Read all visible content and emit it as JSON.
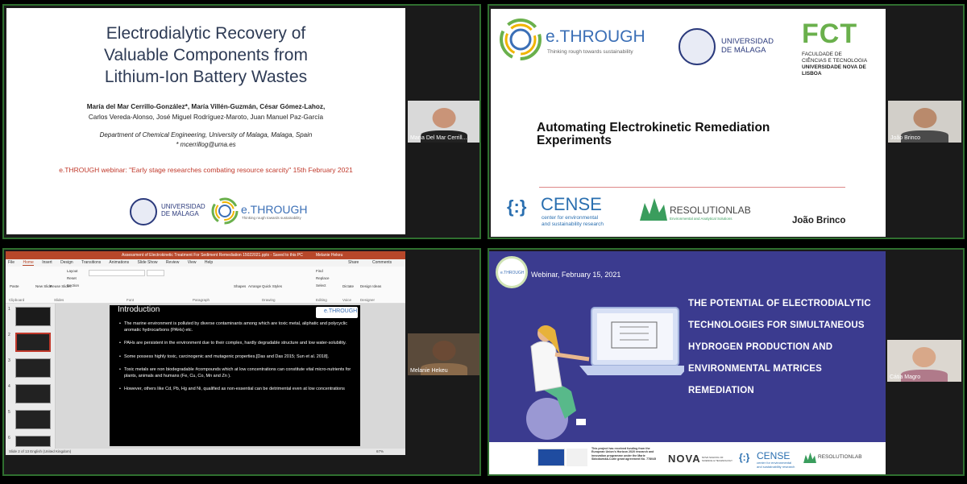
{
  "tiles": [
    {
      "slide": {
        "title_lines": [
          "Electrodialytic Recovery of",
          "Valuable Components from",
          "Lithium-Ion Battery Wastes"
        ],
        "authors_line1": "María del Mar Cerrillo-González*, María Villén-Guzmán, César Gómez-Lahoz,",
        "authors_line2": "Carlos Vereda-Alonso, José Miguel Rodríguez-Maroto, Juan Manuel Paz-García",
        "dept": "Department  of Chemical Engineering, University of Malaga, Malaga, Spain",
        "email": "* mcerrillog@uma.es",
        "webinar": "e.THROUGH webinar:  \"Early stage researches combating resource scarcity\" 15th February 2021",
        "logo_uni": [
          "UNIVERSIDAD",
          "DE MÁLAGA"
        ],
        "logo_brand": "e.THROUGH",
        "logo_tagline": "Thinking rough towards sustainability"
      },
      "participant": "María Del Mar Cerrill..."
    },
    {
      "slide": {
        "brand": "e.THROUGH",
        "brand_tagline": "Thinking rough towards sustainability",
        "uni": [
          "UNIVERSIDAD",
          "DE MÁLAGA"
        ],
        "fct": "FCT",
        "fct_lines": [
          "FACULDADE DE",
          "CIÊNCIAS E TECNOLOGIA",
          "UNIVERSIDADE NOVA DE LISBOA"
        ],
        "title_lines": [
          "Automating Electrokinetic Remediation",
          "Experiments"
        ],
        "cense": "CENSE",
        "cense_sub": [
          "center for environmental",
          "and sustainability research"
        ],
        "resolution": "RESOLUTIONLAB",
        "resolution_sub": "Environmental and Analytical Solutions",
        "presenter": "João Brinco"
      },
      "participant": "João Brinco"
    },
    {
      "ppt": {
        "window_title": "Assessment of  Electrokinetic  Treatment For Sediment Remediation 15022021.pptx  -  Saved to this PC",
        "user": "Melanie Hekeu",
        "tabs": [
          "File",
          "Home",
          "Insert",
          "Design",
          "Transitions",
          "Animations",
          "Slide Show",
          "Review",
          "View",
          "Help"
        ],
        "share": "Share",
        "comments": "Comments",
        "ribbon_buttons": [
          "Paste",
          "New Slide",
          "Reuse Slides",
          "Layout",
          "Reset",
          "Section",
          "Shapes",
          "Arrange",
          "Quick Styles",
          "Find",
          "Replace",
          "Select",
          "Dictate",
          "Design Ideas"
        ],
        "ribbon_groups": [
          "Clipboard",
          "Slides",
          "Font",
          "Paragraph",
          "Drawing",
          "Editing",
          "Voice",
          "Designer"
        ],
        "thumb_numbers": [
          "1",
          "2",
          "3",
          "4",
          "5",
          "6"
        ],
        "status": "Slide 2 of 13     English (United Kingdom)",
        "zoom": "67%",
        "slide_title": "Introduction",
        "slide_logo": "e.THROUGH",
        "bullets": [
          "The marine environment is polluted by diverse contaminants among which are toxic metal, aliphatic and polycyclic aromatic hydrocarbons (PAHs) etc.",
          "PAHs are persistent in the environment due to their complex, hardly degradable structure and low water-solubility.",
          "Some possess highly toxic, carcinogenic and mutagenic properties.[Das and Das 2015; Sun et al. 2018].",
          "Toxic metals are non biodegradable #compounds which at low concentrations can constitute vital micro-nutrients for plants, animals and humans (Fe, Cu, Co, Mn and Zn ).",
          "However, others like Cd, Pb, Hg and Ni, qualified as non-essential can be detrimental even at low concentrations"
        ]
      },
      "participant": "Melanie Hekeu"
    },
    {
      "slide": {
        "logo": "e.THROUGH",
        "date": "Webinar, February 15, 2021",
        "heading_lines": [
          "THE POTENTIAL OF ELECTRODIALYTIC",
          "TECHNOLOGIES FOR SIMULTANEOUS",
          "HYDROGEN PRODUCTION AND",
          "ENVIRONMENTAL MATRICES",
          "REMEDIATION"
        ],
        "eu_label": "European Commission",
        "project_text": "This project has received funding from the European Union's Horizon 2020 research and innovation programme under the Marie Skłodowska-Curie grant agreement No. 778045",
        "nova": "NOVA",
        "nova_sub": "NOVA SCHOOL OF SCIENCE & TECHNOLOGY",
        "cense": "CENSE",
        "cense_sub": [
          "center for environmental",
          "and sustainability research"
        ],
        "resolution": "RESOLUTIONLAB"
      },
      "participant": "Cátia Magro"
    }
  ],
  "colors": {
    "active_border": "#2f6f2f",
    "slide_title_blue": "#2e3b55",
    "accent_red": "#c0392b",
    "ppt_red": "#b7472a",
    "purple_bg": "#3b3b8f"
  }
}
